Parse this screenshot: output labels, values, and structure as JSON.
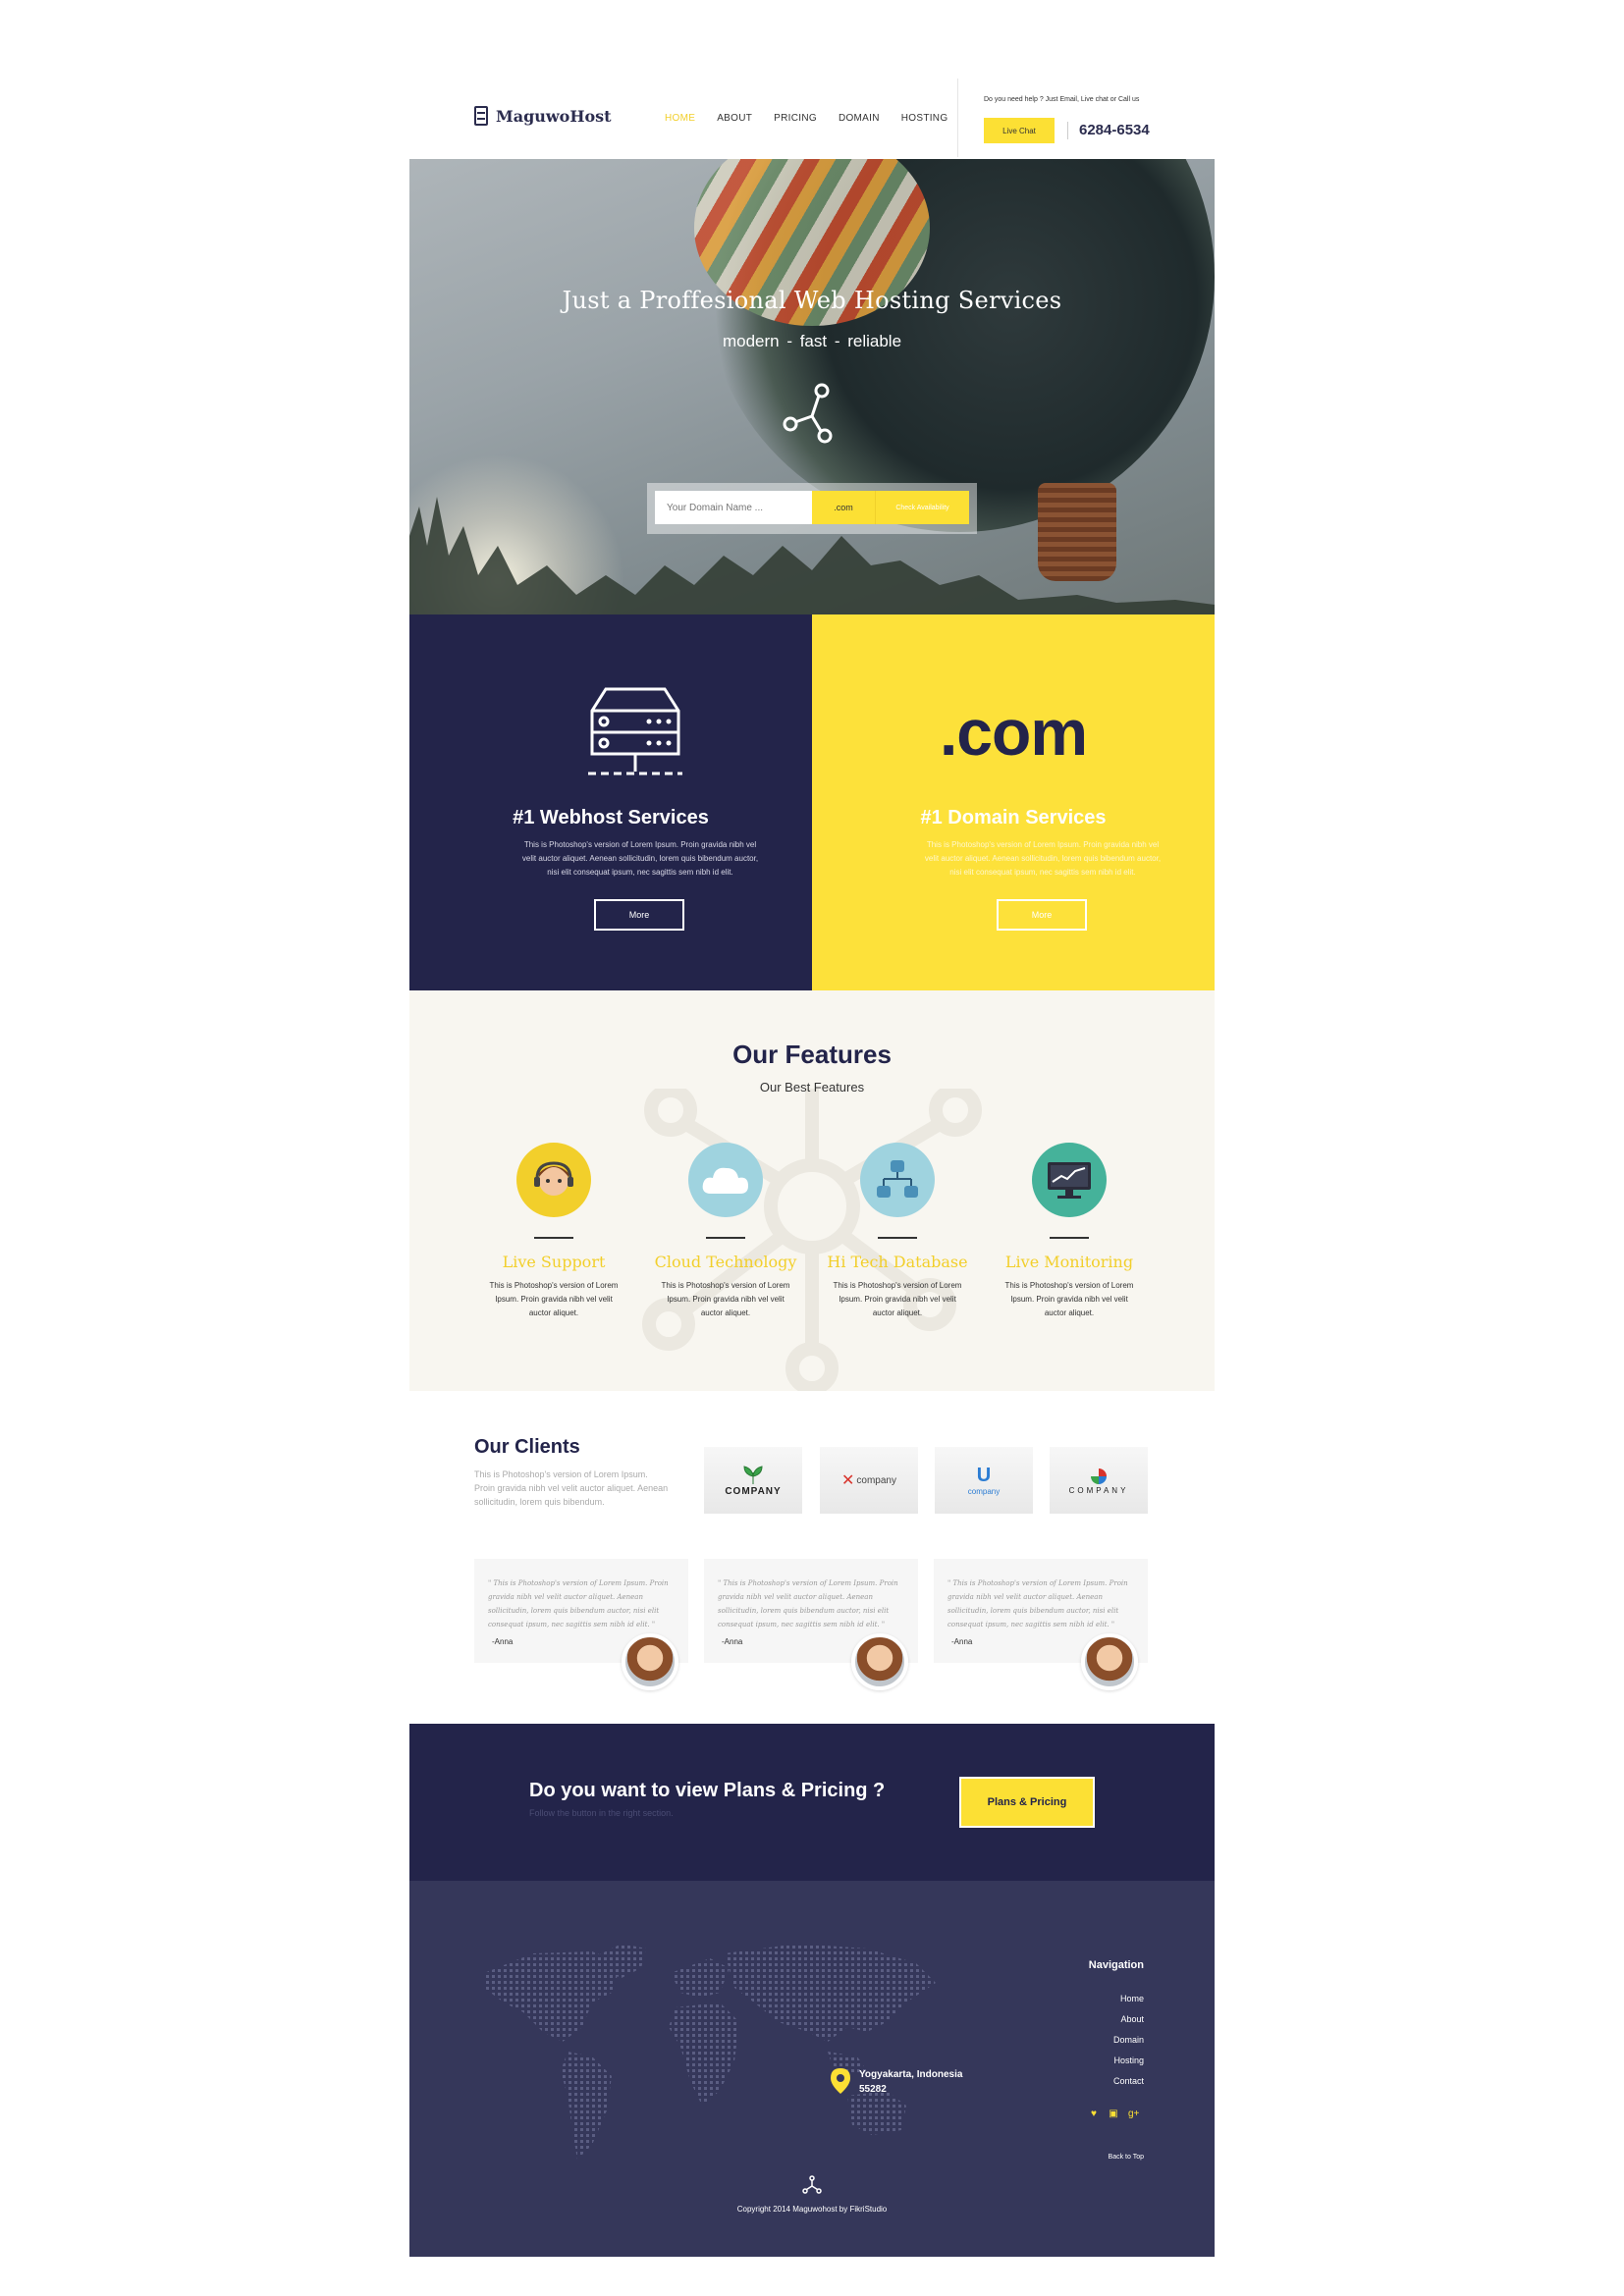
{
  "brand": {
    "name": "MaguwoHost"
  },
  "nav": {
    "items": [
      "HOME",
      "ABOUT",
      "PRICING",
      "DOMAIN",
      "HOSTING"
    ]
  },
  "help": {
    "text": "Do you need help ? Just Email, Live chat or Call us",
    "chat_label": "Live Chat",
    "phone": "6284-6534"
  },
  "hero": {
    "title": "Just a Proffesional Web Hosting Services",
    "subtitle": "modern  -  fast  -  reliable",
    "search_placeholder": "Your Domain Name ...",
    "tld": ".com",
    "check_label": "Check Availability"
  },
  "services": [
    {
      "title": "#1 Webhost Services",
      "text": "This is Photoshop's version  of Lorem Ipsum. Proin gravida nibh vel velit auctor aliquet. Aenean sollicitudin, lorem quis bibendum auctor, nisi elit consequat ipsum, nec sagittis sem nibh id elit.",
      "button": "More"
    },
    {
      "big": ".com",
      "title": "#1 Domain Services",
      "text": "This is Photoshop's version  of Lorem Ipsum. Proin gravida nibh vel velit auctor aliquet. Aenean sollicitudin, lorem quis bibendum auctor, nisi elit consequat ipsum, nec sagittis sem nibh id elit.",
      "button": "More"
    }
  ],
  "features": {
    "title": "Our Features",
    "subtitle": "Our Best Features",
    "items": [
      {
        "name": "Live Support",
        "text": "This is Photoshop's version  of Lorem Ipsum. Proin gravida nibh vel velit auctor aliquet.",
        "color": "#f2cf2b",
        "icon": "headset-icon"
      },
      {
        "name": "Cloud Technology",
        "text": "This is Photoshop's version  of Lorem Ipsum. Proin gravida nibh vel velit auctor aliquet.",
        "color": "#9fd3df",
        "icon": "cloud-icon"
      },
      {
        "name": "Hi Tech Database",
        "text": "This is Photoshop's version  of Lorem Ipsum. Proin gravida nibh vel velit auctor aliquet.",
        "color": "#9fd3df",
        "icon": "database-icon"
      },
      {
        "name": "Live Monitoring",
        "text": "This is Photoshop's version  of Lorem Ipsum. Proin gravida nibh vel velit auctor aliquet.",
        "color": "#45b29a",
        "icon": "monitor-icon"
      }
    ]
  },
  "clients": {
    "title": "Our Clients",
    "text": "This is Photoshop's version  of Lorem Ipsum. Proin gravida nibh vel velit auctor aliquet. Aenean sollicitudin, lorem quis bibendum.",
    "logos": [
      "COMPANY",
      "company",
      "company",
      "COMPANY"
    ]
  },
  "testimonials": [
    {
      "quote": "\" This is Photoshop's version  of Lorem Ipsum. Proin gravida nibh vel velit auctor aliquet. Aenean sollicitudin, lorem quis bibendum auctor, nisi elit consequat ipsum, nec sagittis sem nibh id elit. \"",
      "name": "-Anna"
    },
    {
      "quote": "\" This is Photoshop's version  of Lorem Ipsum. Proin gravida nibh vel velit auctor aliquet. Aenean sollicitudin, lorem quis bibendum auctor, nisi elit consequat ipsum, nec sagittis sem nibh id elit. \"",
      "name": "-Anna"
    },
    {
      "quote": "\" This is Photoshop's version  of Lorem Ipsum. Proin gravida nibh vel velit auctor aliquet. Aenean sollicitudin, lorem quis bibendum auctor, nisi elit consequat ipsum, nec sagittis sem nibh id elit. \"",
      "name": "-Anna"
    }
  ],
  "cta": {
    "title": "Do you want to view Plans & Pricing ?",
    "subtitle": "Follow the button in the right section.",
    "button": "Plans & Pricing"
  },
  "footer": {
    "location": "Yogyakarta, Indonesia",
    "postcode": "55282",
    "nav_title": "Navigation",
    "nav_items": [
      "Home",
      "About",
      "Domain",
      "Hosting",
      "Contact"
    ],
    "socials": [
      "twitter-icon",
      "instagram-icon",
      "google-plus-icon"
    ],
    "back_to_top": "Back to Top",
    "copyright": "Copyright 2014 Maguwohost by FikriStudio"
  },
  "colors": {
    "navy": "#23244a",
    "yellow": "#fde13a",
    "footer": "#35375a",
    "cream": "#f8f6f0"
  }
}
